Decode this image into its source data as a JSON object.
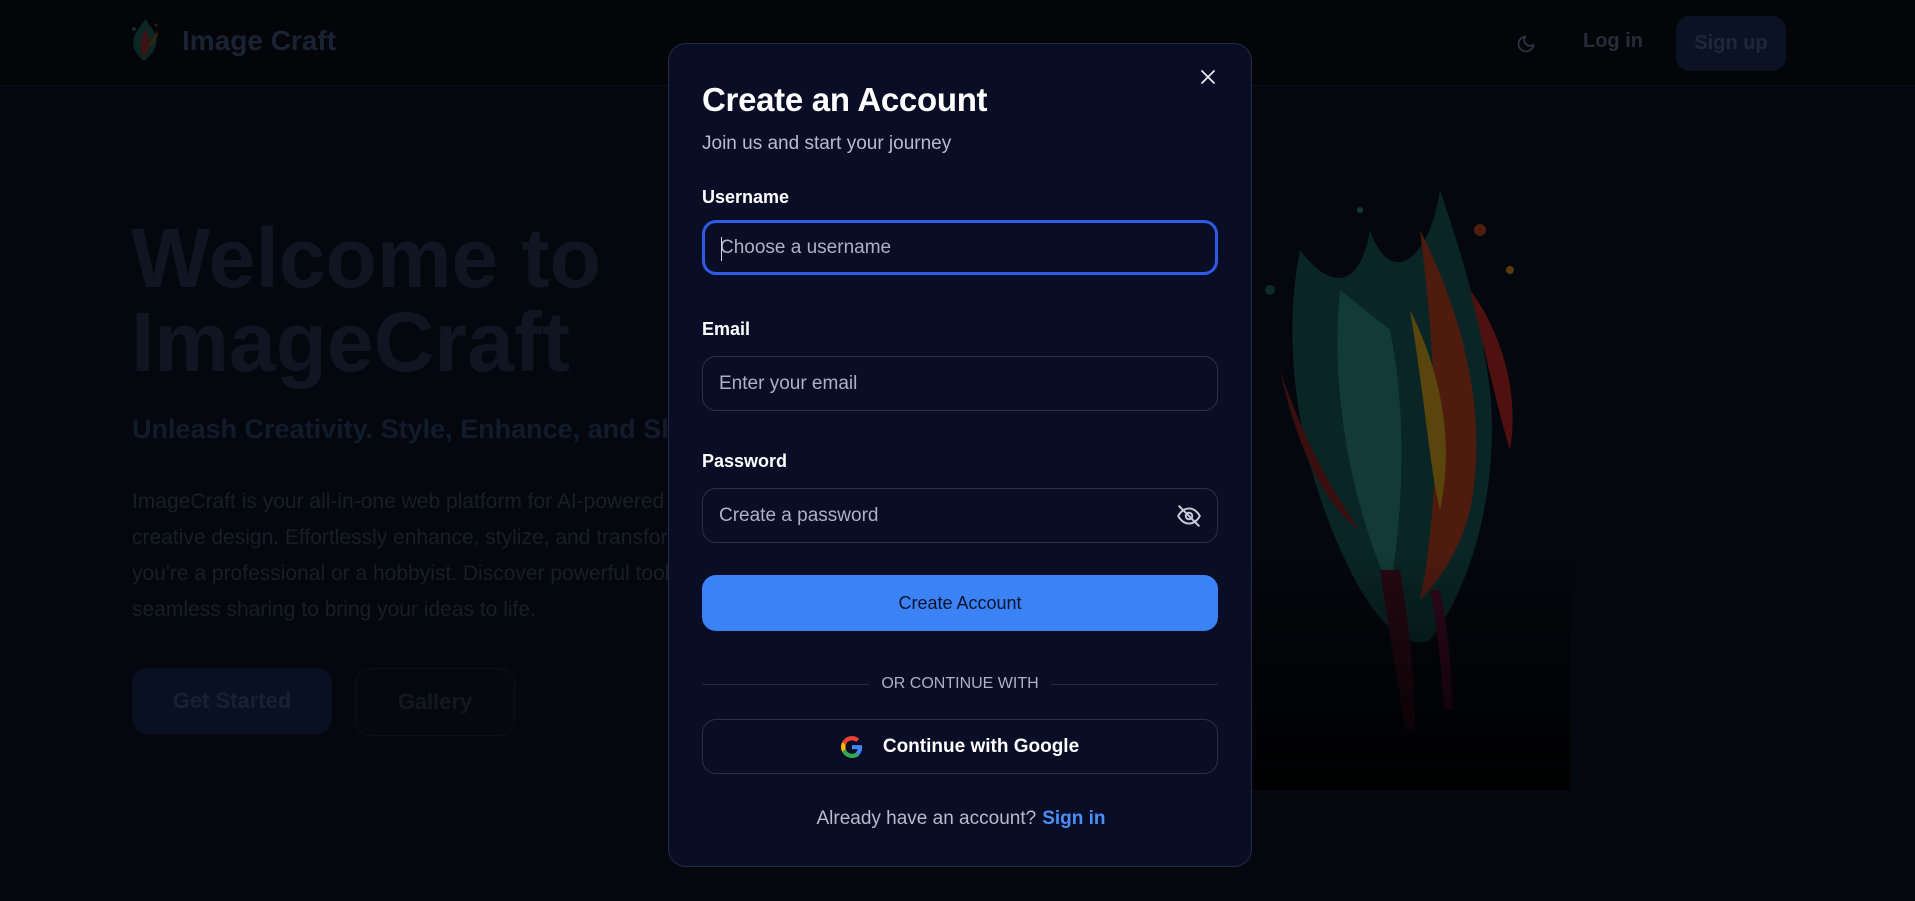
{
  "nav": {
    "brand": "Image Craft",
    "login": "Log in",
    "signup": "Sign up"
  },
  "hero": {
    "title_line1": "Welcome to",
    "title_line2": "ImageCraft",
    "subtitle": "Unleash Creativity. Style, Enhance, and Shar",
    "description_lines": [
      "ImageCraft is your all-in-one web platform for AI-powered",
      "creative design. Effortlessly enhance, stylize, and transform",
      "you're a professional or a hobbyist. Discover powerful tools",
      "seamless sharing to bring your ideas to life."
    ],
    "get_started": "Get Started",
    "gallery": "Gallery"
  },
  "modal": {
    "title": "Create an Account",
    "subtitle": "Join us and start your journey",
    "username_label": "Username",
    "username_placeholder": "Choose a username",
    "username_value": "",
    "email_label": "Email",
    "email_placeholder": "Enter your email",
    "email_value": "",
    "password_label": "Password",
    "password_placeholder": "Create a password",
    "password_value": "",
    "submit": "Create Account",
    "divider": "OR CONTINUE WITH",
    "google": "Continue with Google",
    "signin_prompt": "Already have an account?",
    "signin_link": "Sign in"
  },
  "colors": {
    "accent": "#3b82f6",
    "focus_ring": "#2f5ae6",
    "modal_bg": "#0a0d26",
    "link": "#4b8ef7"
  },
  "icons": [
    "logo-icon",
    "moon-icon",
    "close-icon",
    "eye-off-icon",
    "google-icon"
  ]
}
